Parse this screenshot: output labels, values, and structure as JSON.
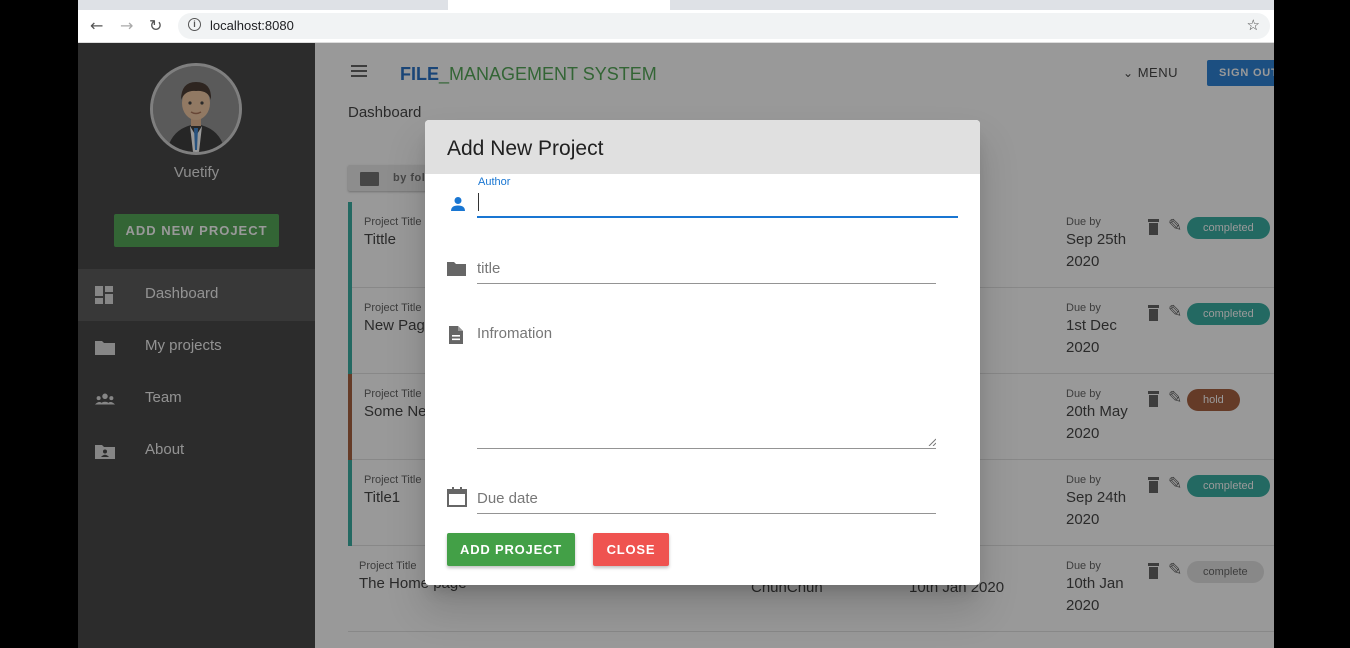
{
  "browser": {
    "url": "localhost:8080"
  },
  "sidebar": {
    "username": "Vuetify",
    "add_button": "ADD NEW PROJECT",
    "items": [
      {
        "label": "Dashboard",
        "icon": "dashboard-icon",
        "active": true
      },
      {
        "label": "My projects",
        "icon": "folder-icon",
        "active": false
      },
      {
        "label": "Team",
        "icon": "people-icon",
        "active": false
      },
      {
        "label": "About",
        "icon": "account-box-icon",
        "active": false
      }
    ]
  },
  "header": {
    "brand_part1": "FILE",
    "brand_part2": "_MANAGEMENT SYSTEM",
    "menu_label": "MENU",
    "sign_out": "SIGN OUT"
  },
  "page": {
    "breadcrumb": "Dashboard",
    "sort_button": "by folder"
  },
  "projects": {
    "caption_title": "Project Title",
    "caption_due": "Due by",
    "rows": [
      {
        "title": "Tittle",
        "person": "",
        "date_frag": "020",
        "due_line1": "Sep 25th",
        "due_line2": "2020",
        "status": "completed",
        "status_color": "#26a69a"
      },
      {
        "title": "New Page",
        "person": "",
        "date_frag": "20",
        "due_line1": "1st Dec",
        "due_line2": "2020",
        "status": "completed",
        "status_color": "#26a69a"
      },
      {
        "title": "Some New",
        "person": "",
        "date_frag": "020",
        "due_line1": "20th May",
        "due_line2": "2020",
        "status": "hold",
        "status_color": "#a0522d"
      },
      {
        "title": "Title1",
        "person": "",
        "date_frag": "020",
        "due_line1": "Sep 24th",
        "due_line2": "2020",
        "status": "completed",
        "status_color": "#26a69a"
      },
      {
        "title": "The Home page",
        "person": "ChunChun",
        "date_frag": "10th Jan 2020",
        "due_line1": "10th Jan",
        "due_line2": "2020",
        "status": "complete",
        "status_color": "#e0e0e0"
      }
    ]
  },
  "dialog": {
    "title": "Add New Project",
    "author_label": "Author",
    "author_value": "",
    "title_placeholder": "title",
    "info_placeholder": "Infromation",
    "due_placeholder": "Due date",
    "add_button": "ADD PROJECT",
    "close_button": "CLOSE"
  },
  "colors": {
    "primary": "#1976d2",
    "success": "#43a047",
    "danger": "#ef5350",
    "drawer": "#363636"
  }
}
